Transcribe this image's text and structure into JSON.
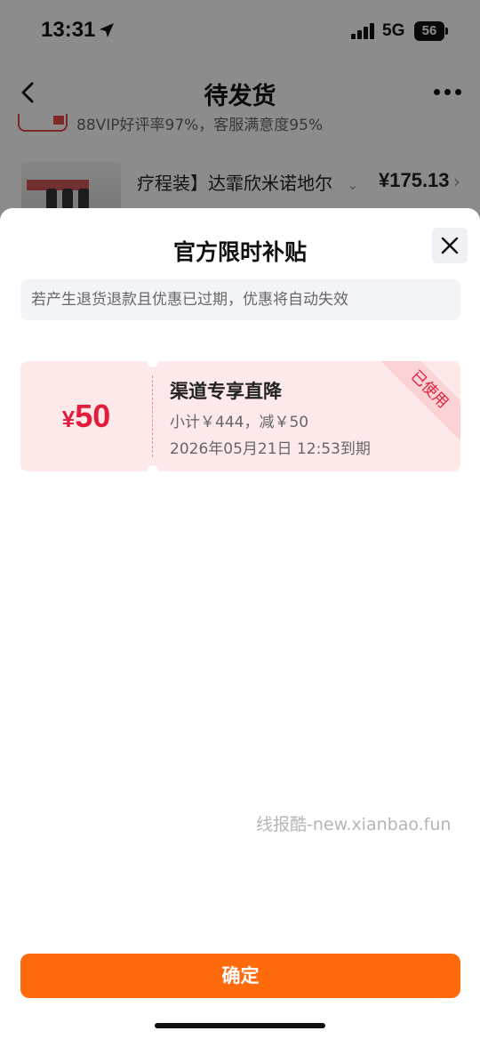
{
  "status_bar": {
    "time": "13:31",
    "network": "5G",
    "battery": "56"
  },
  "nav": {
    "title": "待发货"
  },
  "background": {
    "rating_text": "88VIP好评率97%，客服满意度95%",
    "product_title": "疗程装】达霏欣米诺地尔",
    "product_price": "¥175.13"
  },
  "sheet": {
    "title": "官方限时补贴",
    "notice": "若产生退货退款且优惠已过期，优惠将自动失效",
    "coupon": {
      "currency": "¥",
      "amount": "50",
      "name": "渠道专享直降",
      "detail": "小计￥444，减￥50",
      "expiry": "2026年05月21日 12:53到期",
      "status_ribbon": "已使用"
    },
    "confirm_label": "确定"
  },
  "watermark": "线报酷-new.xianbao.fun",
  "colors": {
    "accent": "#ff6a0d",
    "coupon_red": "#e21c3a",
    "coupon_bg": "#fde9ea"
  }
}
